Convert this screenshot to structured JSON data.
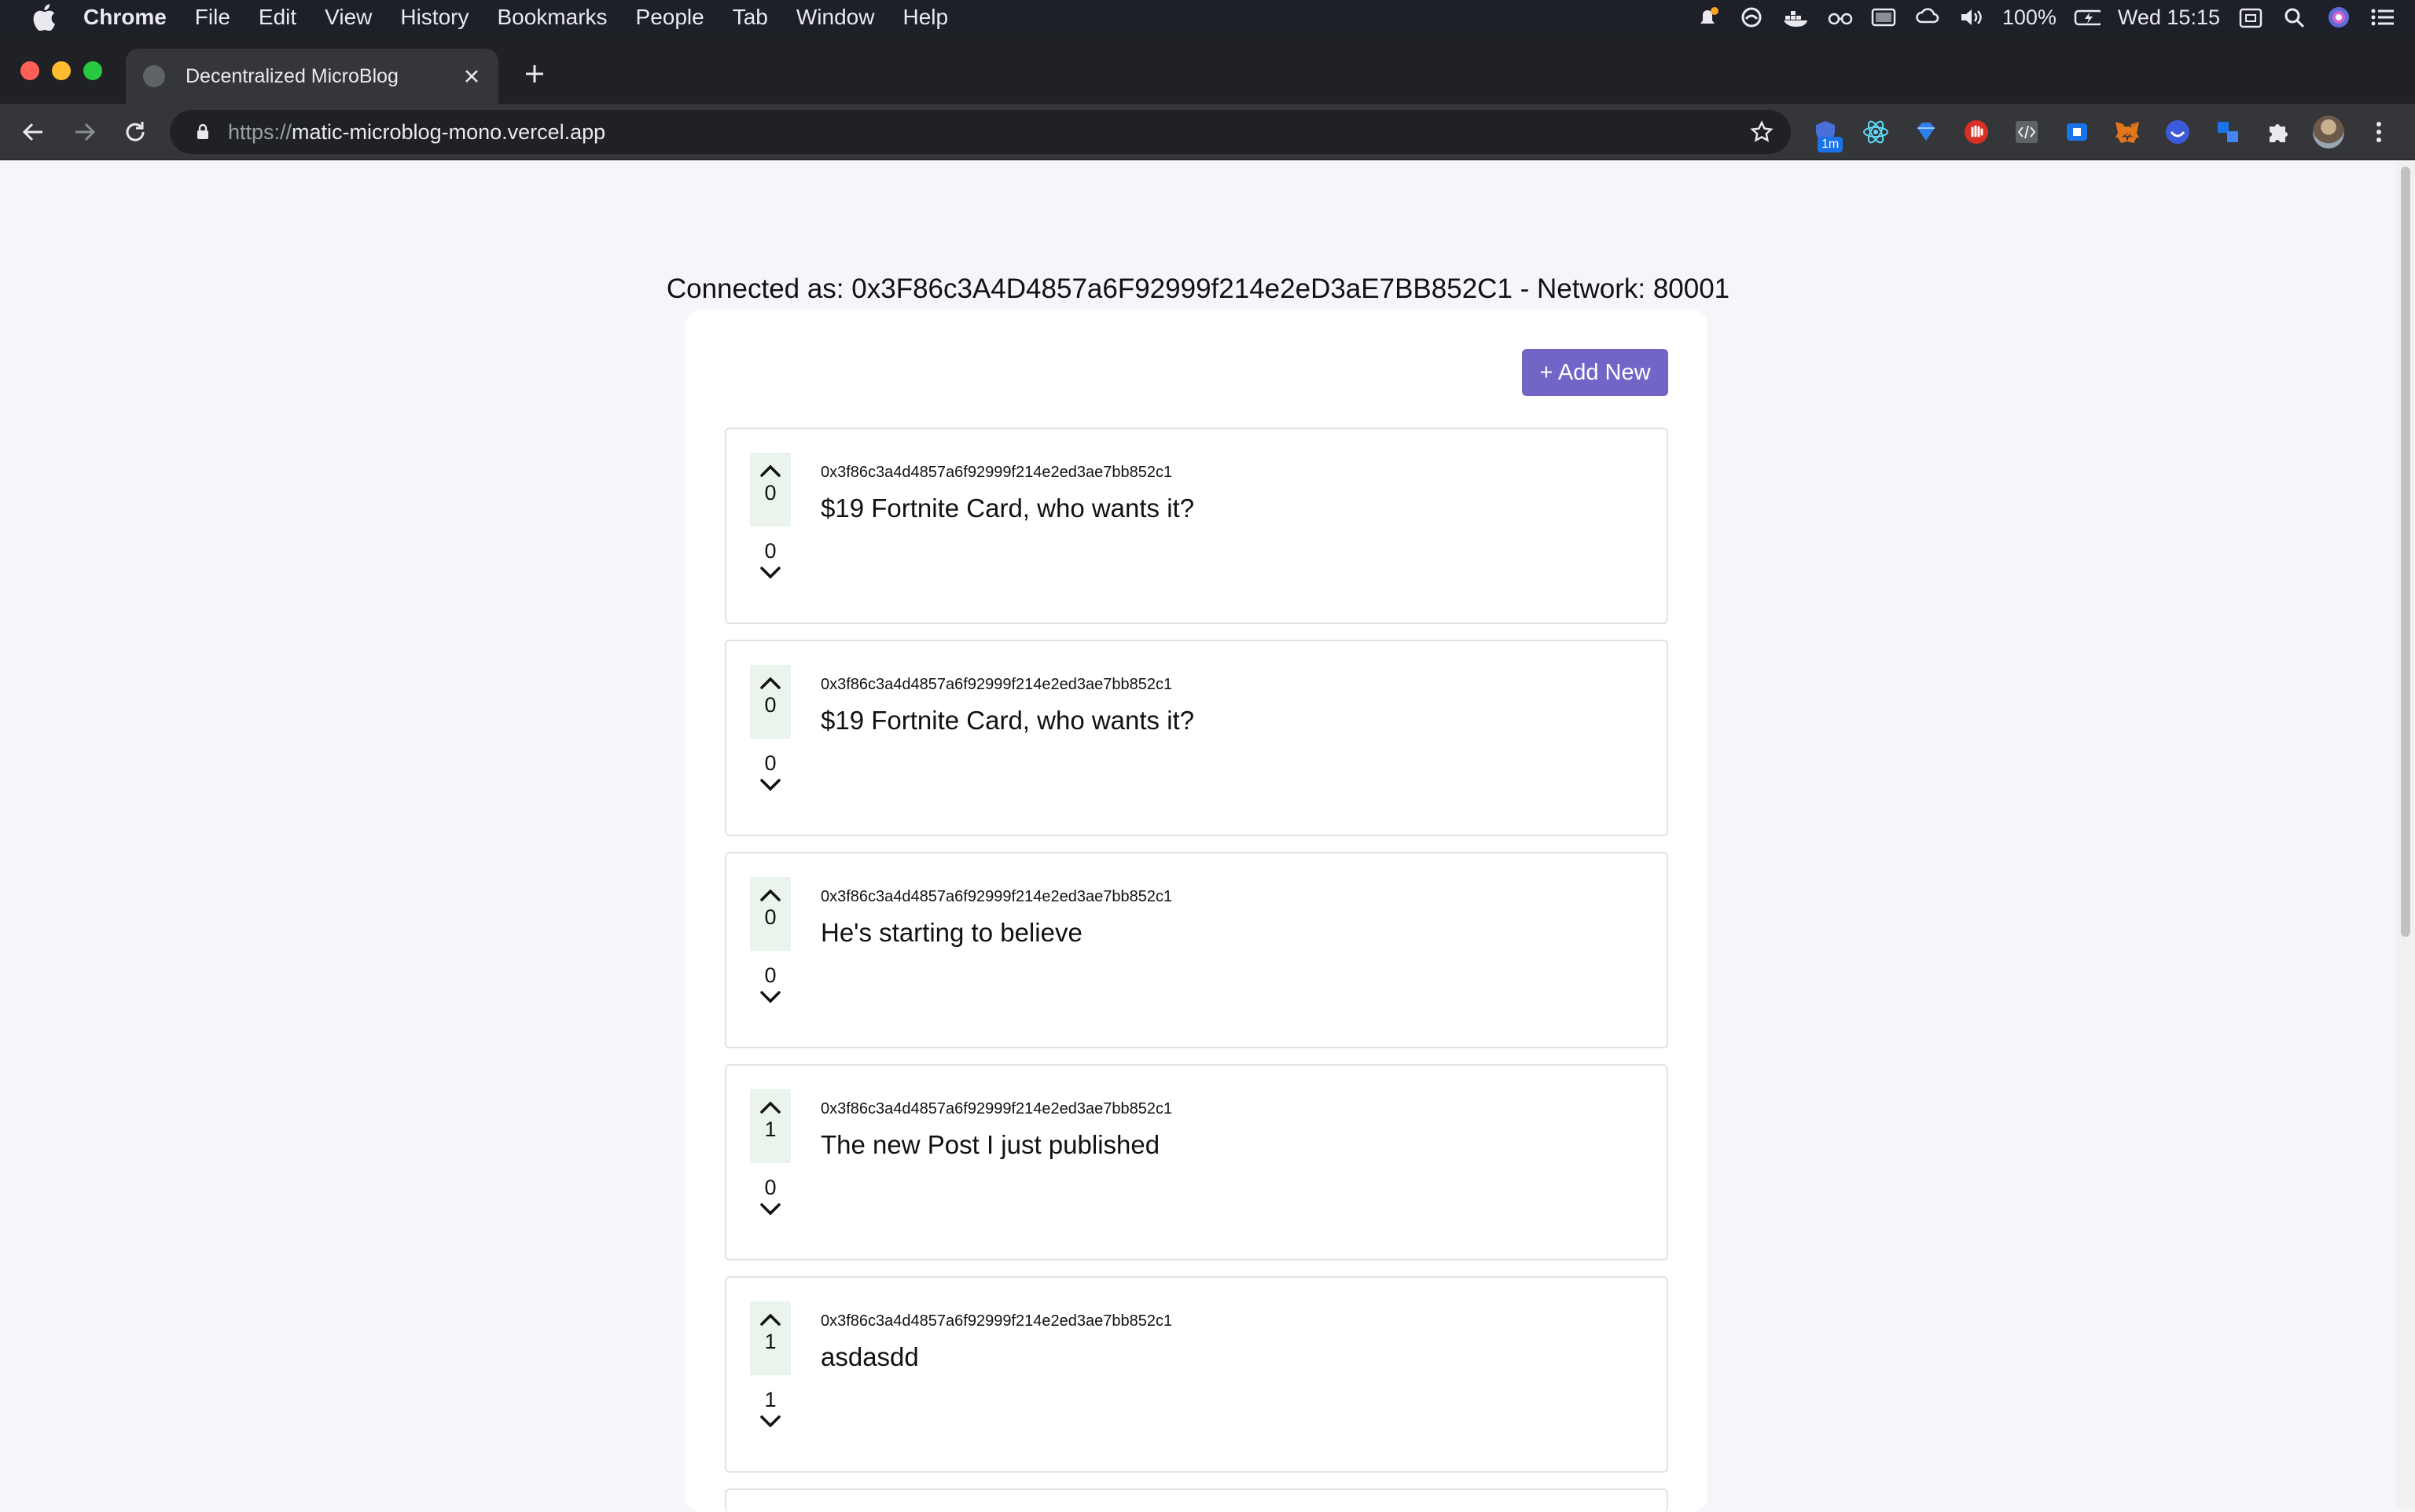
{
  "menubar": {
    "app": "Chrome",
    "items": [
      "File",
      "Edit",
      "View",
      "History",
      "Bookmarks",
      "People",
      "Tab",
      "Window",
      "Help"
    ],
    "battery": "100%",
    "clock": "Wed 15:15"
  },
  "browser": {
    "tab_title": "Decentralized MicroBlog",
    "url_scheme": "https://",
    "url_host": "matic-microblog-mono.vercel.app",
    "ext_badge": "1m"
  },
  "page": {
    "connected": "Connected as: 0x3F86c3A4D4857a6F92999f214e2eD3aE7BB852C1 - Network: 80001",
    "add_new_label": "+ Add New",
    "posts": [
      {
        "author": "0x3f86c3a4d4857a6f92999f214e2ed3ae7bb852c1",
        "text": "$19 Fortnite Card, who wants it?",
        "upvotes": "0",
        "downvotes": "0"
      },
      {
        "author": "0x3f86c3a4d4857a6f92999f214e2ed3ae7bb852c1",
        "text": "$19 Fortnite Card, who wants it?",
        "upvotes": "0",
        "downvotes": "0"
      },
      {
        "author": "0x3f86c3a4d4857a6f92999f214e2ed3ae7bb852c1",
        "text": "He's starting to believe",
        "upvotes": "0",
        "downvotes": "0"
      },
      {
        "author": "0x3f86c3a4d4857a6f92999f214e2ed3ae7bb852c1",
        "text": "The new Post I just published",
        "upvotes": "1",
        "downvotes": "0"
      },
      {
        "author": "0x3f86c3a4d4857a6f92999f214e2ed3ae7bb852c1",
        "text": "asdasdd",
        "upvotes": "1",
        "downvotes": "1"
      }
    ]
  },
  "colors": {
    "accent": "#7166c7",
    "upvote_bg": "#eaf4ec",
    "page_bg": "#f4f6fa"
  }
}
